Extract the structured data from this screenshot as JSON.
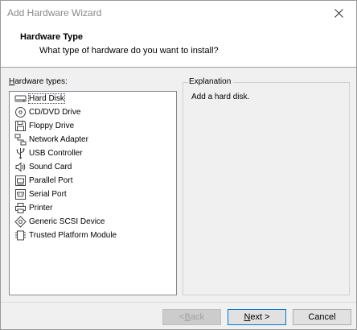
{
  "window": {
    "title": "Add Hardware Wizard"
  },
  "header": {
    "title": "Hardware Type",
    "subtitle": "What type of hardware do you want to install?"
  },
  "hardware_list": {
    "label_prefix": "H",
    "label_rest": "ardware types:",
    "selected_index": 0,
    "items": [
      {
        "label": "Hard Disk",
        "icon": "hard-disk-icon"
      },
      {
        "label": "CD/DVD Drive",
        "icon": "cd-dvd-icon"
      },
      {
        "label": "Floppy Drive",
        "icon": "floppy-icon"
      },
      {
        "label": "Network Adapter",
        "icon": "network-icon"
      },
      {
        "label": "USB Controller",
        "icon": "usb-icon"
      },
      {
        "label": "Sound Card",
        "icon": "sound-icon"
      },
      {
        "label": "Parallel Port",
        "icon": "parallel-port-icon"
      },
      {
        "label": "Serial Port",
        "icon": "serial-port-icon"
      },
      {
        "label": "Printer",
        "icon": "printer-icon"
      },
      {
        "label": "Generic SCSI Device",
        "icon": "scsi-icon"
      },
      {
        "label": "Trusted Platform Module",
        "icon": "tpm-icon"
      }
    ]
  },
  "explanation": {
    "legend": "Explanation",
    "text": "Add a hard disk."
  },
  "buttons": {
    "back_prefix": "< ",
    "back_ul": "B",
    "back_rest": "ack",
    "next_ul": "N",
    "next_rest": "ext >",
    "cancel": "Cancel"
  }
}
